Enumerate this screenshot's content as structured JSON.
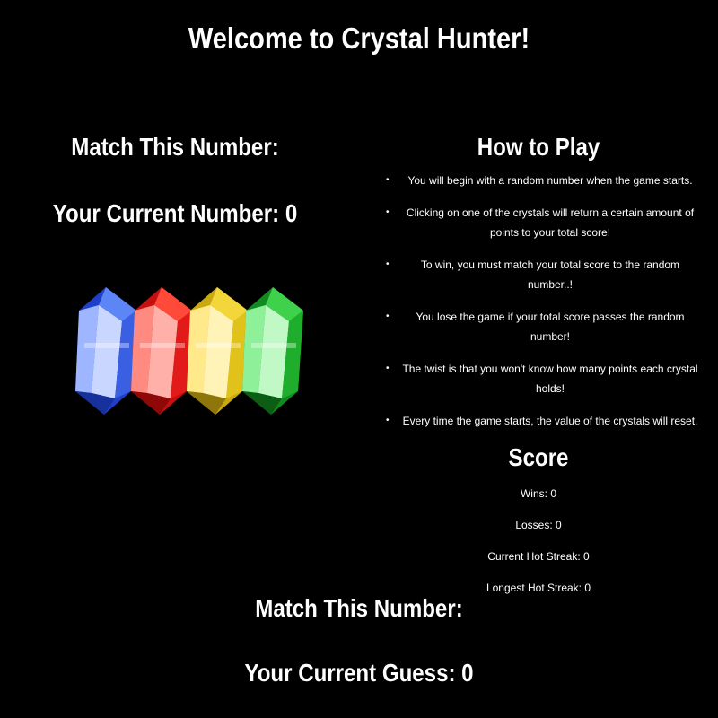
{
  "title": "Welcome to Crystal Hunter!",
  "left": {
    "target_label": "Match This Number:",
    "current_label": "Your Current Number: 0"
  },
  "crystals": [
    {
      "name": "blue-crystal",
      "color": "#2f55d8"
    },
    {
      "name": "red-crystal",
      "color": "#e21a1a"
    },
    {
      "name": "yellow-crystal",
      "color": "#e0c21a"
    },
    {
      "name": "green-crystal",
      "color": "#1fae2c"
    }
  ],
  "how_to_play": {
    "title": "How to Play",
    "bullet": "•",
    "rules": [
      "You will begin with a random number when the game starts.",
      "Clicking on one of the crystals will return a certain amount of points to your total score!",
      "To win, you must match your total score to the random number..!",
      "You lose the game if your total score passes the random number!",
      "The twist is that you won't know how many points each crystal holds!",
      "Every time the game starts, the value of the crystals will reset."
    ]
  },
  "score": {
    "title": "Score",
    "wins": "Wins: 0",
    "losses": "Losses: 0",
    "current_streak": "Current Hot Streak: 0",
    "longest_streak": "Longest Hot Streak: 0"
  },
  "bottom": {
    "target_label": "Match This Number:",
    "guess_label": "Your Current Guess: 0"
  }
}
